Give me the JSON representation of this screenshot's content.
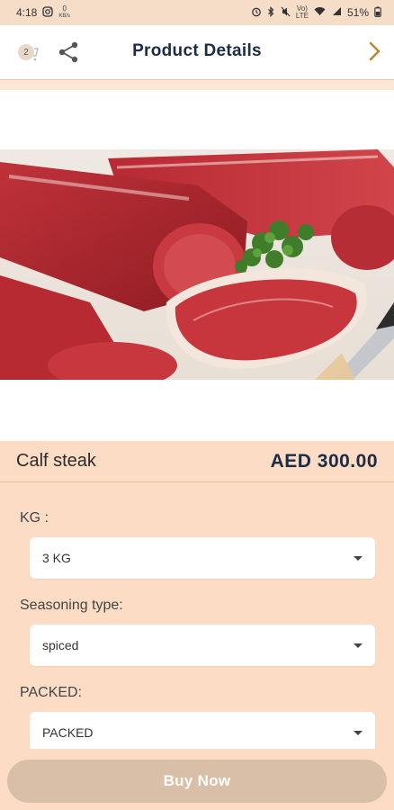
{
  "status_bar": {
    "time": "4:18",
    "data_rate_top": "0",
    "data_rate_unit": "KB/s",
    "network_top": "Vo)",
    "network_bottom": "LTE",
    "battery_percent": "51%"
  },
  "header": {
    "title": "Product Details",
    "cart_count": "2"
  },
  "product": {
    "name": "Calf steak",
    "price": "AED 300.00",
    "image_alt": "Cuts of raw beef steak with parsley and a knife"
  },
  "options": {
    "kg": {
      "label": "KG :",
      "value": "3 KG"
    },
    "seasoning": {
      "label": "Seasoning type:",
      "value": "spiced"
    },
    "packed": {
      "label": "PACKED:",
      "value": "PACKED"
    }
  },
  "actions": {
    "buy_now": "Buy Now"
  },
  "colors": {
    "page_bg": "#fcdcc4",
    "title": "#1d2b45",
    "accent_arrow": "#b98a2e",
    "buy_button": "#d9bfa8"
  }
}
